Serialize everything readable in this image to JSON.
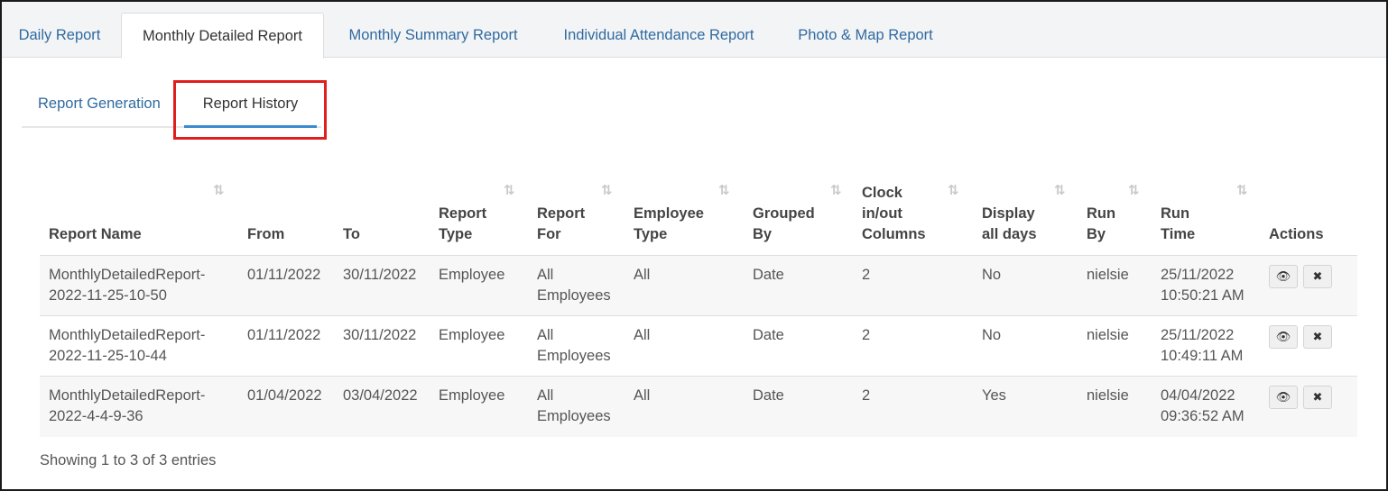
{
  "top_tabs": [
    {
      "label": "Daily Report"
    },
    {
      "label": "Monthly Detailed Report"
    },
    {
      "label": "Monthly Summary Report"
    },
    {
      "label": "Individual Attendance Report"
    },
    {
      "label": "Photo & Map Report"
    }
  ],
  "sub_tabs": [
    {
      "label": "Report Generation"
    },
    {
      "label": "Report History"
    }
  ],
  "table": {
    "columns": [
      {
        "lines": [
          "Report Name"
        ]
      },
      {
        "lines": [
          "From"
        ]
      },
      {
        "lines": [
          "To"
        ]
      },
      {
        "lines": [
          "Report",
          "Type"
        ]
      },
      {
        "lines": [
          "Report",
          "For"
        ]
      },
      {
        "lines": [
          "Employee",
          "Type"
        ]
      },
      {
        "lines": [
          "Grouped",
          "By"
        ]
      },
      {
        "lines": [
          "Clock",
          "in/out",
          "Columns"
        ]
      },
      {
        "lines": [
          "Display",
          "all days"
        ]
      },
      {
        "lines": [
          "Run",
          "By"
        ]
      },
      {
        "lines": [
          "Run",
          "Time"
        ]
      },
      {
        "lines": [
          "Actions"
        ]
      }
    ],
    "sort_glyph": "⇅",
    "rows": [
      {
        "name": [
          "MonthlyDetailedReport-",
          "2022-11-25-10-50"
        ],
        "from": "01/11/2022",
        "to": "30/11/2022",
        "type": "Employee",
        "for": [
          "All",
          "Employees"
        ],
        "emp_type": "All",
        "grouped": "Date",
        "clock": "2",
        "display": "No",
        "run_by": "nielsie",
        "run_time": [
          "25/11/2022",
          "10:50:21 AM"
        ]
      },
      {
        "name": [
          "MonthlyDetailedReport-",
          "2022-11-25-10-44"
        ],
        "from": "01/11/2022",
        "to": "30/11/2022",
        "type": "Employee",
        "for": [
          "All",
          "Employees"
        ],
        "emp_type": "All",
        "grouped": "Date",
        "clock": "2",
        "display": "No",
        "run_by": "nielsie",
        "run_time": [
          "25/11/2022",
          "10:49:11 AM"
        ]
      },
      {
        "name": [
          "MonthlyDetailedReport-",
          "2022-4-4-9-36"
        ],
        "from": "01/04/2022",
        "to": "03/04/2022",
        "type": "Employee",
        "for": [
          "All",
          "Employees"
        ],
        "emp_type": "All",
        "grouped": "Date",
        "clock": "2",
        "display": "Yes",
        "run_by": "nielsie",
        "run_time": [
          "04/04/2022",
          "09:36:52 AM"
        ]
      }
    ],
    "actions": {
      "view_glyph": "👁",
      "delete_glyph": "✖"
    }
  },
  "footer": {
    "info": "Showing 1 to 3 of 3 entries"
  },
  "colors": {
    "link": "#2f6aa0",
    "active_underline": "#3a8bd0",
    "highlight": "#e01e1e"
  }
}
